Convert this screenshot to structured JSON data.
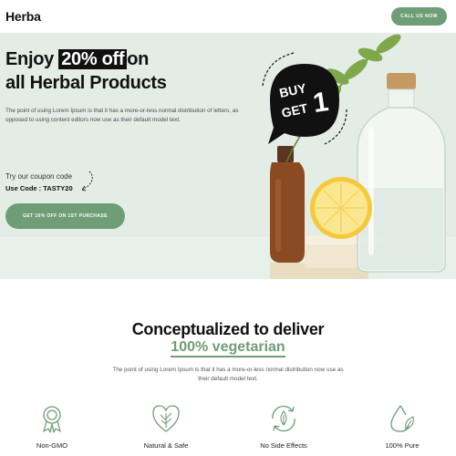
{
  "header": {
    "logo": "Herba",
    "call_button": "CALL US NOW"
  },
  "hero": {
    "headline_pre": "Enjoy",
    "headline_highlight": "20% off",
    "headline_post": "on",
    "headline_line2": "all Herbal Products",
    "description": "The point of using Lorem Ipsum is that it has a more-or-less normal distribution of letters, as opposed to using content editors now use as their default model text.",
    "coupon_label": "Try our coupon code",
    "coupon_code": "Use Code : TASTY20",
    "cta_button": "GET 10% OFF ON 1ST PURCHASE",
    "badge_line1": "BUY",
    "badge_line2": "GET",
    "badge_number": "1"
  },
  "section": {
    "title": "Conceptualized to deliver",
    "accent": "100% vegetarian",
    "description": "The point of using Lorem Ipsum is that it has a more-or-less normal distribution now use as their default model text."
  },
  "features": [
    {
      "title": "Non-GMO",
      "icon": "award-badge-icon"
    },
    {
      "title": "Natural & Safe",
      "icon": "leaf-heart-icon"
    },
    {
      "title": "No Side Effects",
      "icon": "leaf-recycle-icon"
    },
    {
      "title": "100% Pure",
      "icon": "drop-leaf-icon"
    }
  ],
  "colors": {
    "accent": "#6e9d76",
    "hero_bg": "#e3ede6",
    "text_dark": "#111111"
  }
}
